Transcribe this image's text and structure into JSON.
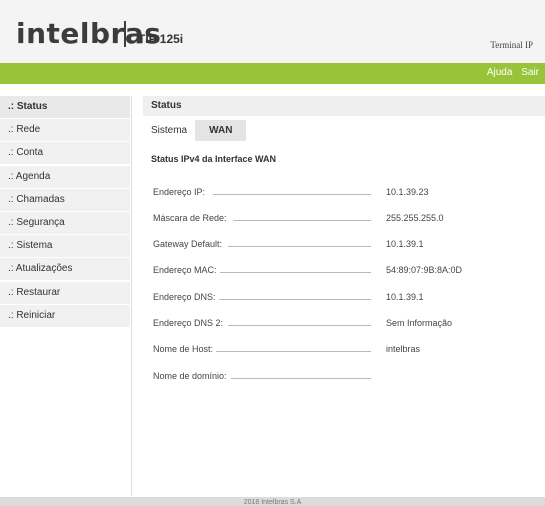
{
  "header": {
    "logo_text": "intelbras",
    "model": "TIP 125i",
    "terminal": "Terminal IP"
  },
  "topbar": {
    "help": "Ajuda",
    "logout": "Sair"
  },
  "sidebar": {
    "items": [
      {
        "label": ".: Status",
        "active": true
      },
      {
        "label": ".: Rede"
      },
      {
        "label": ".: Conta"
      },
      {
        "label": ".: Agenda"
      },
      {
        "label": ".: Chamadas"
      },
      {
        "label": ".: Segurança"
      },
      {
        "label": ".: Sistema"
      },
      {
        "label": ".: Atualizações"
      },
      {
        "label": ".: Restaurar"
      },
      {
        "label": ".: Reiniciar"
      }
    ]
  },
  "main": {
    "title": "Status",
    "tabs": [
      {
        "label": "Sistema"
      },
      {
        "label": "WAN",
        "active": true
      }
    ],
    "section_title": "Status IPv4 da Interface WAN",
    "rows": [
      {
        "label": "Endereço IP:",
        "value": "10.1.39.23"
      },
      {
        "label": "Máscara de Rede:",
        "value": "255.255.255.0"
      },
      {
        "label": "Gateway Default:",
        "value": "10.1.39.1"
      },
      {
        "label": "Endereço MAC:",
        "value": "54:89:07:9B:8A:0D"
      },
      {
        "label": "Endereço DNS:",
        "value": "10.1.39.1"
      },
      {
        "label": "Endereço DNS 2:",
        "value": "Sem Informação"
      },
      {
        "label": "Nome de Host:",
        "value": "intelbras"
      },
      {
        "label": "Nome de domínio:",
        "value": ""
      }
    ]
  },
  "footer": {
    "text": "2018 Intelbras S.A"
  },
  "colors": {
    "accent": "#99c338",
    "logo": "#3c3c3c"
  }
}
